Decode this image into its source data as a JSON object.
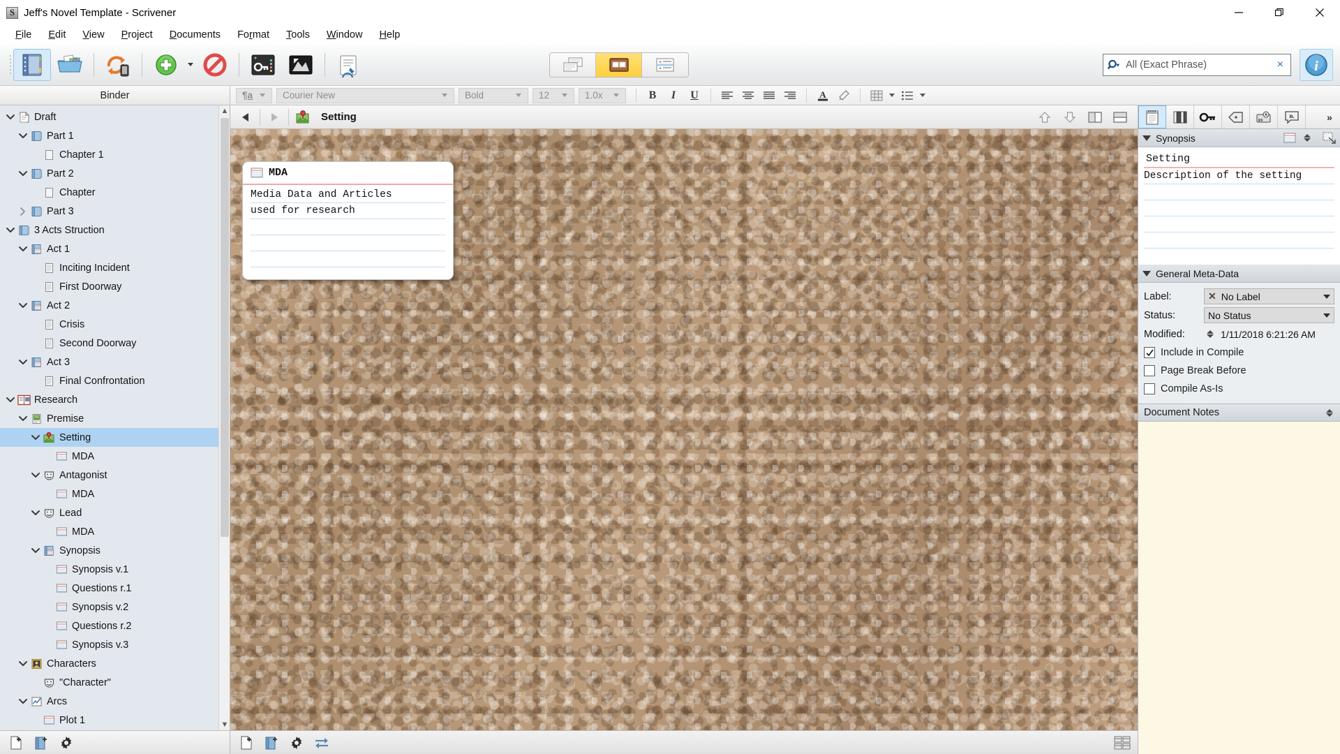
{
  "window": {
    "title": "Jeff's Novel Template - Scrivener",
    "app_icon": "scrivener-logo-icon",
    "minimize": "minimize-icon",
    "maximize": "restore-icon",
    "close": "close-icon"
  },
  "menubar": [
    {
      "label": "File",
      "mnemonic": "F"
    },
    {
      "label": "Edit",
      "mnemonic": "E"
    },
    {
      "label": "View",
      "mnemonic": "V"
    },
    {
      "label": "Project",
      "mnemonic": "P"
    },
    {
      "label": "Documents",
      "mnemonic": "D"
    },
    {
      "label": "Format",
      "mnemonic": "r"
    },
    {
      "label": "Tools",
      "mnemonic": "T"
    },
    {
      "label": "Window",
      "mnemonic": "W"
    },
    {
      "label": "Help",
      "mnemonic": "H"
    }
  ],
  "toolbar": {
    "buttons": [
      {
        "name": "binder-toggle",
        "icon": "notebook-icon",
        "active": true
      },
      {
        "name": "collections",
        "icon": "open-folder-icon",
        "active": false
      },
      {
        "name": "sync",
        "icon": "sync-arrows-icon",
        "active": false
      },
      {
        "name": "add",
        "icon": "green-plus-icon",
        "active": false
      },
      {
        "name": "no-entry",
        "icon": "prohibited-icon",
        "active": false
      },
      {
        "name": "keywords",
        "icon": "key-panel-icon",
        "active": false
      },
      {
        "name": "fullscreen-compose",
        "icon": "compose-mode-icon",
        "active": false
      },
      {
        "name": "compile",
        "icon": "compile-icon",
        "active": false
      }
    ],
    "view_modes": [
      {
        "name": "view-documents",
        "icon": "document-stack-icon",
        "selected": false
      },
      {
        "name": "view-corkboard",
        "icon": "corkboard-icon",
        "selected": true
      },
      {
        "name": "view-outliner",
        "icon": "outliner-icon",
        "selected": false
      }
    ],
    "search": {
      "value": "All (Exact Phrase)",
      "placeholder": "Search",
      "icon": "search-magnifier-icon",
      "clear": "×"
    },
    "info_button": "info-circle-icon"
  },
  "format_bar": {
    "style_selector": "style-paragraph-icon",
    "font": "Courier New",
    "weight": "Bold",
    "size": "12",
    "line_spacing": "1.0x",
    "bold": "B",
    "italic": "I",
    "underline": "U",
    "align_left": "align-left-icon",
    "align_center": "align-center-icon",
    "align_justify": "align-justify-icon",
    "align_right": "align-right-icon",
    "text_color": "A",
    "highlight": "highlighter-icon",
    "table": "table-icon",
    "list": "bullet-list-icon"
  },
  "binder": {
    "header": "Binder",
    "items": [
      {
        "label": "Draft",
        "depth": 0,
        "twisty": "down",
        "icon": "draft-stack-icon",
        "selected": false
      },
      {
        "label": "Part 1",
        "depth": 1,
        "twisty": "down",
        "icon": "folder-icon",
        "selected": false
      },
      {
        "label": "Chapter 1",
        "depth": 2,
        "twisty": "none",
        "icon": "blank-doc-icon",
        "selected": false
      },
      {
        "label": "Part 2",
        "depth": 1,
        "twisty": "down",
        "icon": "folder-icon",
        "selected": false
      },
      {
        "label": "Chapter",
        "depth": 2,
        "twisty": "none",
        "icon": "blank-doc-icon",
        "selected": false
      },
      {
        "label": "Part 3",
        "depth": 1,
        "twisty": "right",
        "icon": "folder-icon",
        "selected": false
      },
      {
        "label": "3 Acts Struction",
        "depth": 0,
        "twisty": "down",
        "icon": "folder-icon",
        "selected": false
      },
      {
        "label": "Act 1",
        "depth": 1,
        "twisty": "down",
        "icon": "folder-card-icon",
        "selected": false
      },
      {
        "label": "Inciting Incident",
        "depth": 2,
        "twisty": "none",
        "icon": "text-doc-icon",
        "selected": false
      },
      {
        "label": "First Doorway",
        "depth": 2,
        "twisty": "none",
        "icon": "text-doc-icon",
        "selected": false
      },
      {
        "label": "Act 2",
        "depth": 1,
        "twisty": "down",
        "icon": "folder-card-icon",
        "selected": false
      },
      {
        "label": "Crisis",
        "depth": 2,
        "twisty": "none",
        "icon": "text-doc-icon",
        "selected": false
      },
      {
        "label": "Second Doorway",
        "depth": 2,
        "twisty": "none",
        "icon": "text-doc-icon",
        "selected": false
      },
      {
        "label": "Act 3",
        "depth": 1,
        "twisty": "down",
        "icon": "folder-card-icon",
        "selected": false
      },
      {
        "label": "Final Confrontation",
        "depth": 2,
        "twisty": "none",
        "icon": "text-doc-icon",
        "selected": false
      },
      {
        "label": "Research",
        "depth": 0,
        "twisty": "down",
        "icon": "research-book-icon",
        "selected": false
      },
      {
        "label": "Premise",
        "depth": 1,
        "twisty": "down",
        "icon": "image-doc-icon",
        "selected": false
      },
      {
        "label": "Setting",
        "depth": 2,
        "twisty": "down",
        "icon": "pin-map-icon",
        "selected": true
      },
      {
        "label": "MDA",
        "depth": 3,
        "twisty": "none",
        "icon": "index-card-icon",
        "selected": false
      },
      {
        "label": "Antagonist",
        "depth": 2,
        "twisty": "down",
        "icon": "character-mask-icon",
        "selected": false
      },
      {
        "label": "MDA",
        "depth": 3,
        "twisty": "none",
        "icon": "index-card-icon",
        "selected": false
      },
      {
        "label": "Lead",
        "depth": 2,
        "twisty": "down",
        "icon": "character-mask-icon",
        "selected": false
      },
      {
        "label": "MDA",
        "depth": 3,
        "twisty": "none",
        "icon": "index-card-icon",
        "selected": false
      },
      {
        "label": "Synopsis",
        "depth": 2,
        "twisty": "down",
        "icon": "folder-card-icon",
        "selected": false
      },
      {
        "label": "Synopsis v.1",
        "depth": 3,
        "twisty": "none",
        "icon": "index-card-icon",
        "selected": false
      },
      {
        "label": "Questions r.1",
        "depth": 3,
        "twisty": "none",
        "icon": "index-card-icon",
        "selected": false
      },
      {
        "label": "Synopsis v.2",
        "depth": 3,
        "twisty": "none",
        "icon": "index-card-icon",
        "selected": false
      },
      {
        "label": "Questions r.2",
        "depth": 3,
        "twisty": "none",
        "icon": "index-card-icon",
        "selected": false
      },
      {
        "label": "Synopsis v.3",
        "depth": 3,
        "twisty": "none",
        "icon": "index-card-icon",
        "selected": false
      },
      {
        "label": "Characters",
        "depth": 1,
        "twisty": "down",
        "icon": "person-badge-icon",
        "selected": false
      },
      {
        "label": "\"Character\"",
        "depth": 2,
        "twisty": "none",
        "icon": "character-mask-icon",
        "selected": false
      },
      {
        "label": "Arcs",
        "depth": 1,
        "twisty": "down",
        "icon": "chart-line-icon",
        "selected": false
      },
      {
        "label": "Plot 1",
        "depth": 2,
        "twisty": "none",
        "icon": "index-card-icon",
        "selected": false
      }
    ],
    "footer": [
      {
        "name": "add-document-button",
        "icon": "new-document-icon"
      },
      {
        "name": "add-folder-button",
        "icon": "new-folder-icon"
      },
      {
        "name": "binder-options-button",
        "icon": "gear-icon"
      }
    ]
  },
  "editor": {
    "back": "back-arrow-icon",
    "forward": "forward-arrow-icon",
    "doc_icon": "pin-map-icon",
    "title": "Setting",
    "header_buttons": [
      {
        "name": "go-up-button",
        "icon": "up-arrow-icon"
      },
      {
        "name": "go-down-button",
        "icon": "down-arrow-icon"
      },
      {
        "name": "split-vertical-button",
        "icon": "split-vertical-icon"
      },
      {
        "name": "split-horizontal-button",
        "icon": "split-horizontal-icon"
      }
    ],
    "card": {
      "icon": "index-card-icon",
      "title": "MDA",
      "lines": [
        "Media Data and Articles",
        "used for research",
        "",
        "",
        ""
      ]
    },
    "footer": [
      {
        "name": "new-document-button",
        "icon": "new-document-icon"
      },
      {
        "name": "new-folder-button",
        "icon": "new-folder-icon"
      },
      {
        "name": "corkboard-settings-button",
        "icon": "gear-icon"
      },
      {
        "name": "swap-editors-button",
        "icon": "swap-arrows-icon"
      }
    ],
    "footer_right": {
      "name": "corkboard-layout-button",
      "icon": "grid-layout-icon"
    }
  },
  "inspector": {
    "tabs": [
      {
        "name": "tab-notes",
        "icon": "notepad-icon",
        "selected": true
      },
      {
        "name": "tab-references",
        "icon": "books-icon",
        "selected": false
      },
      {
        "name": "tab-keywords",
        "icon": "key-icon",
        "selected": false
      },
      {
        "name": "tab-metadata",
        "icon": "tag-icon",
        "selected": false
      },
      {
        "name": "tab-snapshots",
        "icon": "camera-icon",
        "selected": false
      },
      {
        "name": "tab-comments",
        "icon": "comment-bubble-icon",
        "selected": false
      },
      {
        "name": "tab-more",
        "icon": "chevron-double-right-icon",
        "selected": false,
        "label": "»"
      }
    ],
    "synopsis": {
      "header": "Synopsis",
      "card_icon": "index-card-icon",
      "spinner_icon": "updown-spinner-icon",
      "image_icon": "synopsis-image-icon",
      "title": "Setting",
      "lines": [
        "Description of the setting",
        "",
        "",
        "",
        ""
      ]
    },
    "metadata": {
      "header": "General Meta-Data",
      "label_label": "Label:",
      "label_value": "No Label",
      "label_x_icon": "x-mark-icon",
      "status_label": "Status:",
      "status_value": "No Status",
      "modified_label": "Modified:",
      "modified_value": "1/11/2018 6:21:26 AM",
      "checkboxes": [
        {
          "label": "Include in Compile",
          "checked": true
        },
        {
          "label": "Page Break Before",
          "checked": false
        },
        {
          "label": "Compile As-Is",
          "checked": false
        }
      ]
    },
    "notes": {
      "header": "Document Notes",
      "spinner_icon": "updown-spinner-icon",
      "body": ""
    }
  }
}
